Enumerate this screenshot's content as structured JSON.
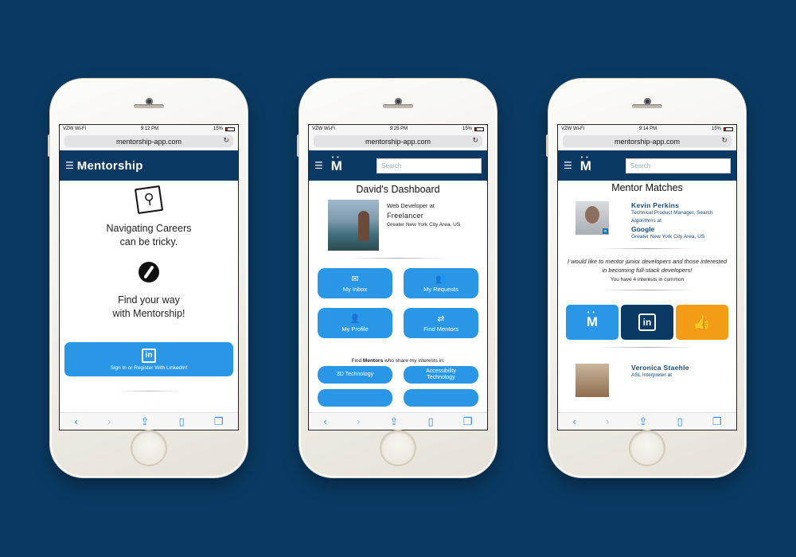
{
  "colors": {
    "background": "#0a3a63",
    "accent": "#2a97e6",
    "orange": "#f39c15"
  },
  "phones": [
    {
      "status": {
        "carrier": "VZW Wi-Fi",
        "time": "9:12 PM",
        "battery": "15%"
      },
      "url": "mentorship-app.com",
      "brand": "Mentorship",
      "headline1": "Navigating Careers\ncan be tricky.",
      "headline2": "Find your way\nwith Mentorship!",
      "linkedin_button": "Sign In or Register With LinkedIn!"
    },
    {
      "status": {
        "carrier": "VZW Wi-Fi",
        "time": "9:25 PM",
        "battery": "15%"
      },
      "url": "mentorship-app.com",
      "search_placeholder": "Search",
      "title": "David's Dashboard",
      "profile": {
        "role": "Web Developer at",
        "company": "Freelancer",
        "location": "Greater New York City Area, US"
      },
      "tiles": [
        {
          "icon": "envelope-icon",
          "label": "My Inbox"
        },
        {
          "icon": "users-icon",
          "label": "My Requests"
        },
        {
          "icon": "user-icon",
          "label": "My Profile"
        },
        {
          "icon": "shuffle-icon",
          "label": "Find Mentors"
        }
      ],
      "interest_label_pre": "Find ",
      "interest_label_strong": "Mentors",
      "interest_label_post": " who share my interests in:",
      "interests": [
        "3D Technology",
        "Accessibility\nTechnology",
        "",
        ""
      ]
    },
    {
      "status": {
        "carrier": "VZW Wi-Fi",
        "time": "9:14 PM",
        "battery": "15%"
      },
      "url": "mentorship-app.com",
      "search_placeholder": "Search",
      "title": "Mentor Matches",
      "mentor1": {
        "name": "Kevin Perkins",
        "role": "Technical Product Manager, Search Algorithms at",
        "company": "Google",
        "location": "Greater New York City Area, US"
      },
      "quote": "I would like to mentor junior developers and those interested in becoming full-stack developers!",
      "common": "You have 4 interests in common",
      "mentor2": {
        "name": "Veronica Staehle",
        "role": "ASL Interpreter at"
      }
    }
  ]
}
